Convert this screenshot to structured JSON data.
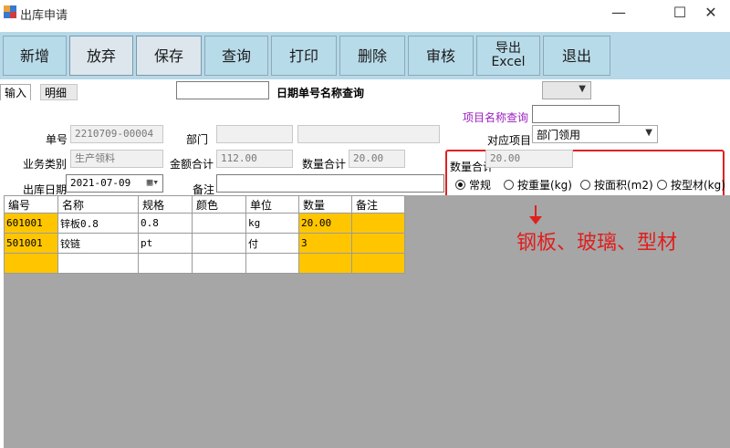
{
  "window": {
    "title": "出库申请",
    "minimize": "—",
    "maximize": "☐",
    "close": "✕"
  },
  "toolbar": [
    {
      "label": "新增"
    },
    {
      "label": "放弃"
    },
    {
      "label": "保存"
    },
    {
      "label": "查询"
    },
    {
      "label": "打印"
    },
    {
      "label": "删除"
    },
    {
      "label": "审核"
    },
    {
      "label": "导出",
      "sublabel": "Excel"
    },
    {
      "label": "退出"
    }
  ],
  "tabs": {
    "input": "输入",
    "detail": "明细"
  },
  "search": {
    "value": "",
    "label": "日期单号名称查询",
    "combo_value": ""
  },
  "form": {
    "project_query_label": "项目名称查询",
    "project_query_value": "",
    "doc_no_label": "单号",
    "doc_no": "2210709-00004",
    "dept_label": "部门",
    "dept_value": "",
    "dept_name": "",
    "project_label": "对应项目",
    "project_value": "部门领用",
    "biz_type_label": "业务类别",
    "biz_type": "生产领料",
    "amount_total_label": "金额合计",
    "amount_total": "112.00",
    "qty_total_label": "数量合计",
    "qty_total": "20.00",
    "qty_total2_label": "数量合计",
    "qty_total2": "20.00",
    "out_date_label": "出库日期",
    "out_date": "2021-07-09",
    "remark_label": "备注",
    "remark": ""
  },
  "calc_mode": {
    "options": [
      "常规",
      "按重量(kg)",
      "按面积(m2)",
      "按型材(kg)"
    ],
    "selected": "常规"
  },
  "annotation": "钢板、玻璃、型材",
  "grid": {
    "columns": [
      "编号",
      "名称",
      "规格",
      "颜色",
      "单位",
      "数量",
      "备注"
    ],
    "rows": [
      [
        "601001",
        "锌板0.8",
        "0.8",
        "",
        "kg",
        "20.00",
        ""
      ],
      [
        "501001",
        "铰链",
        "pt",
        "",
        "付",
        "3",
        ""
      ],
      [
        "",
        "",
        "",
        "",
        "",
        "",
        ""
      ]
    ]
  },
  "colors": {
    "toolbar_bg": "#b6d8e8",
    "highlight": "#ffc600",
    "annotation_red": "#e01e1e",
    "purple_label": "#9b1fbf"
  }
}
